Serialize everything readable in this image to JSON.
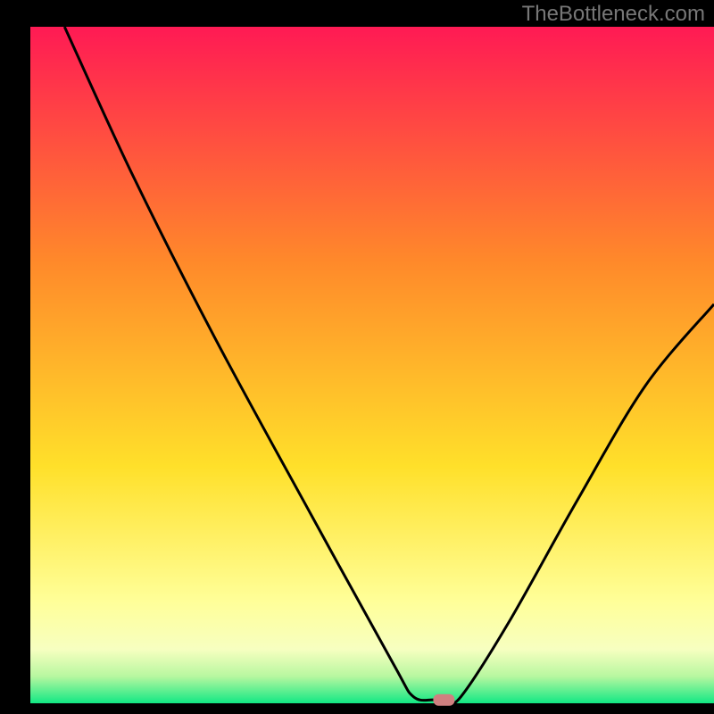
{
  "attribution": "TheBottleneck.com",
  "chart_data": {
    "type": "line",
    "title": "",
    "xlabel": "",
    "ylabel": "",
    "xlim": [
      0,
      100
    ],
    "ylim": [
      0,
      100
    ],
    "grid": false,
    "legend": false,
    "curve": {
      "name": "bottleneck-curve",
      "points": [
        {
          "x": 5,
          "y": 100
        },
        {
          "x": 15,
          "y": 78
        },
        {
          "x": 27,
          "y": 54
        },
        {
          "x": 41,
          "y": 28
        },
        {
          "x": 53,
          "y": 6
        },
        {
          "x": 56,
          "y": 1
        },
        {
          "x": 59,
          "y": 0.5
        },
        {
          "x": 61,
          "y": 0.5
        },
        {
          "x": 63,
          "y": 1
        },
        {
          "x": 70,
          "y": 12
        },
        {
          "x": 80,
          "y": 30
        },
        {
          "x": 90,
          "y": 47
        },
        {
          "x": 100,
          "y": 59
        }
      ]
    },
    "marker": {
      "x": 60.5,
      "y": 0.5,
      "color": "#d08080"
    },
    "background_gradient": {
      "top": "#ff1a54",
      "mid1": "#ff8a2a",
      "mid2": "#ffe02a",
      "band": "#ffff99",
      "bottom": "#12e884"
    },
    "axis_color": "#000000",
    "frame_color": "#000000"
  }
}
